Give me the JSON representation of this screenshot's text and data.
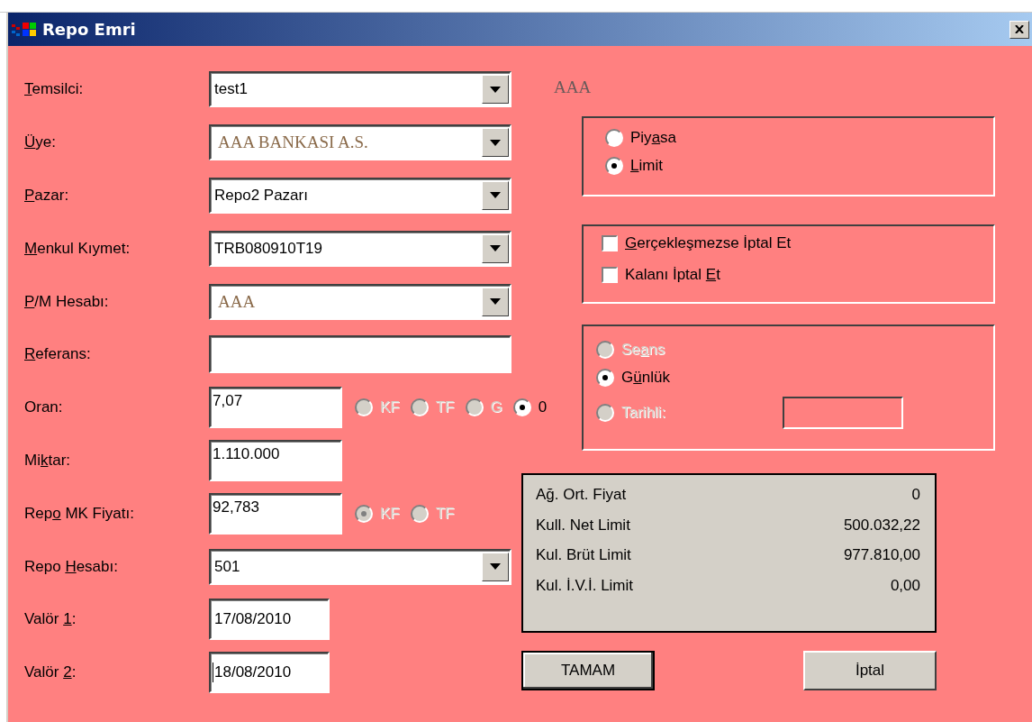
{
  "window": {
    "title": "Repo Emri"
  },
  "fields": [
    {
      "label": [
        {
          "t": "T",
          "u": true
        },
        {
          "t": "emsilci:",
          "u": false
        }
      ],
      "kind": "combo",
      "value": "test1",
      "readonly": false
    },
    {
      "label": [
        {
          "t": "Ü",
          "u": true
        },
        {
          "t": "ye:",
          "u": false
        }
      ],
      "kind": "combo",
      "value": "AAA BANKASI A.S.",
      "readonly": true
    },
    {
      "label": [
        {
          "t": "P",
          "u": true
        },
        {
          "t": "azar:",
          "u": false
        }
      ],
      "kind": "combo",
      "value": "Repo2 Pazarı",
      "readonly": false
    },
    {
      "label": [
        {
          "t": "M",
          "u": true
        },
        {
          "t": "enkul Kıymet:",
          "u": false
        }
      ],
      "kind": "combo",
      "value": "TRB080910T19",
      "readonly": false
    },
    {
      "label": [
        {
          "t": "P",
          "u": true
        },
        {
          "t": "/M Hesabı:",
          "u": false
        }
      ],
      "kind": "combo",
      "value": "AAA",
      "readonly": true
    },
    {
      "label": [
        {
          "t": "R",
          "u": true
        },
        {
          "t": "eferans:",
          "u": false
        }
      ],
      "kind": "text"
    },
    {
      "label": [
        {
          "t": "Oran:",
          "u": false
        }
      ],
      "kind": "short",
      "value": "7,07",
      "radios": [
        {
          "label": "KF",
          "selected": false,
          "disabled": true
        },
        {
          "label": "TF",
          "selected": false,
          "disabled": true
        },
        {
          "label": "G",
          "selected": false,
          "disabled": true
        },
        {
          "label": "0",
          "selected": true,
          "disabled": false
        }
      ]
    },
    {
      "label": [
        {
          "t": "Mi",
          "u": false
        },
        {
          "t": "k",
          "u": true
        },
        {
          "t": "tar:",
          "u": false
        }
      ],
      "kind": "short",
      "value": "1.110.000"
    },
    {
      "label": [
        {
          "t": "Rep",
          "u": false
        },
        {
          "t": "o",
          "u": true
        },
        {
          "t": " MK Fiyatı:",
          "u": false
        }
      ],
      "kind": "short",
      "value": "92,783",
      "radios": [
        {
          "label": "KF",
          "selected": true,
          "disabled": true
        },
        {
          "label": "TF",
          "selected": false,
          "disabled": true
        }
      ]
    },
    {
      "label": [
        {
          "t": "Repo ",
          "u": false
        },
        {
          "t": "H",
          "u": true
        },
        {
          "t": "esabı:",
          "u": false
        }
      ],
      "kind": "combo",
      "value": "501",
      "readonly": false
    },
    {
      "label": [
        {
          "t": "Valör ",
          "u": false
        },
        {
          "t": "1",
          "u": true
        },
        {
          "t": ":",
          "u": false
        }
      ],
      "kind": "date",
      "value": "17/08/2010",
      "focused": false
    },
    {
      "label": [
        {
          "t": "Valör ",
          "u": false
        },
        {
          "t": "2",
          "u": true
        },
        {
          "t": ":",
          "u": false
        }
      ],
      "kind": "date",
      "value": "18/08/2010",
      "focused": true
    }
  ],
  "account_name": "AAA",
  "order_type": [
    {
      "label": [
        {
          "t": "Piy",
          "u": false
        },
        {
          "t": "a",
          "u": true
        },
        {
          "t": "sa",
          "u": false
        }
      ],
      "selected": false
    },
    {
      "label": [
        {
          "t": "L",
          "u": true
        },
        {
          "t": "imit",
          "u": false
        }
      ],
      "selected": true
    }
  ],
  "options": [
    {
      "label": [
        {
          "t": "G",
          "u": true
        },
        {
          "t": "erçekleşmezse İptal Et",
          "u": false
        }
      ],
      "checked": false
    },
    {
      "label": [
        {
          "t": "Kalanı İptal ",
          "u": false
        },
        {
          "t": "E",
          "u": true
        },
        {
          "t": "t",
          "u": false
        }
      ],
      "checked": false
    }
  ],
  "validity": [
    {
      "label": [
        {
          "t": "Se",
          "u": false
        },
        {
          "t": "a",
          "u": true
        },
        {
          "t": "ns",
          "u": false
        }
      ],
      "selected": false,
      "disabled": true
    },
    {
      "label": [
        {
          "t": "G",
          "u": false
        },
        {
          "t": "ü",
          "u": true
        },
        {
          "t": "nlük",
          "u": false
        }
      ],
      "selected": true,
      "disabled": false
    },
    {
      "label": [
        {
          "t": "Tarihli:",
          "u": false
        }
      ],
      "selected": false,
      "disabled": true
    }
  ],
  "summary": [
    {
      "label": "Ağ. Ort. Fiyat",
      "value": "0"
    },
    {
      "label": "Kull. Net Limit",
      "value": "500.032,22"
    },
    {
      "label": "Kul. Brüt Limit",
      "value": "977.810,00"
    },
    {
      "label": "Kul. İ.V.İ. Limit",
      "value": "0,00"
    }
  ],
  "buttons": [
    {
      "label": "TAMAM",
      "default": true
    },
    {
      "label": "İptal",
      "default": false
    }
  ]
}
